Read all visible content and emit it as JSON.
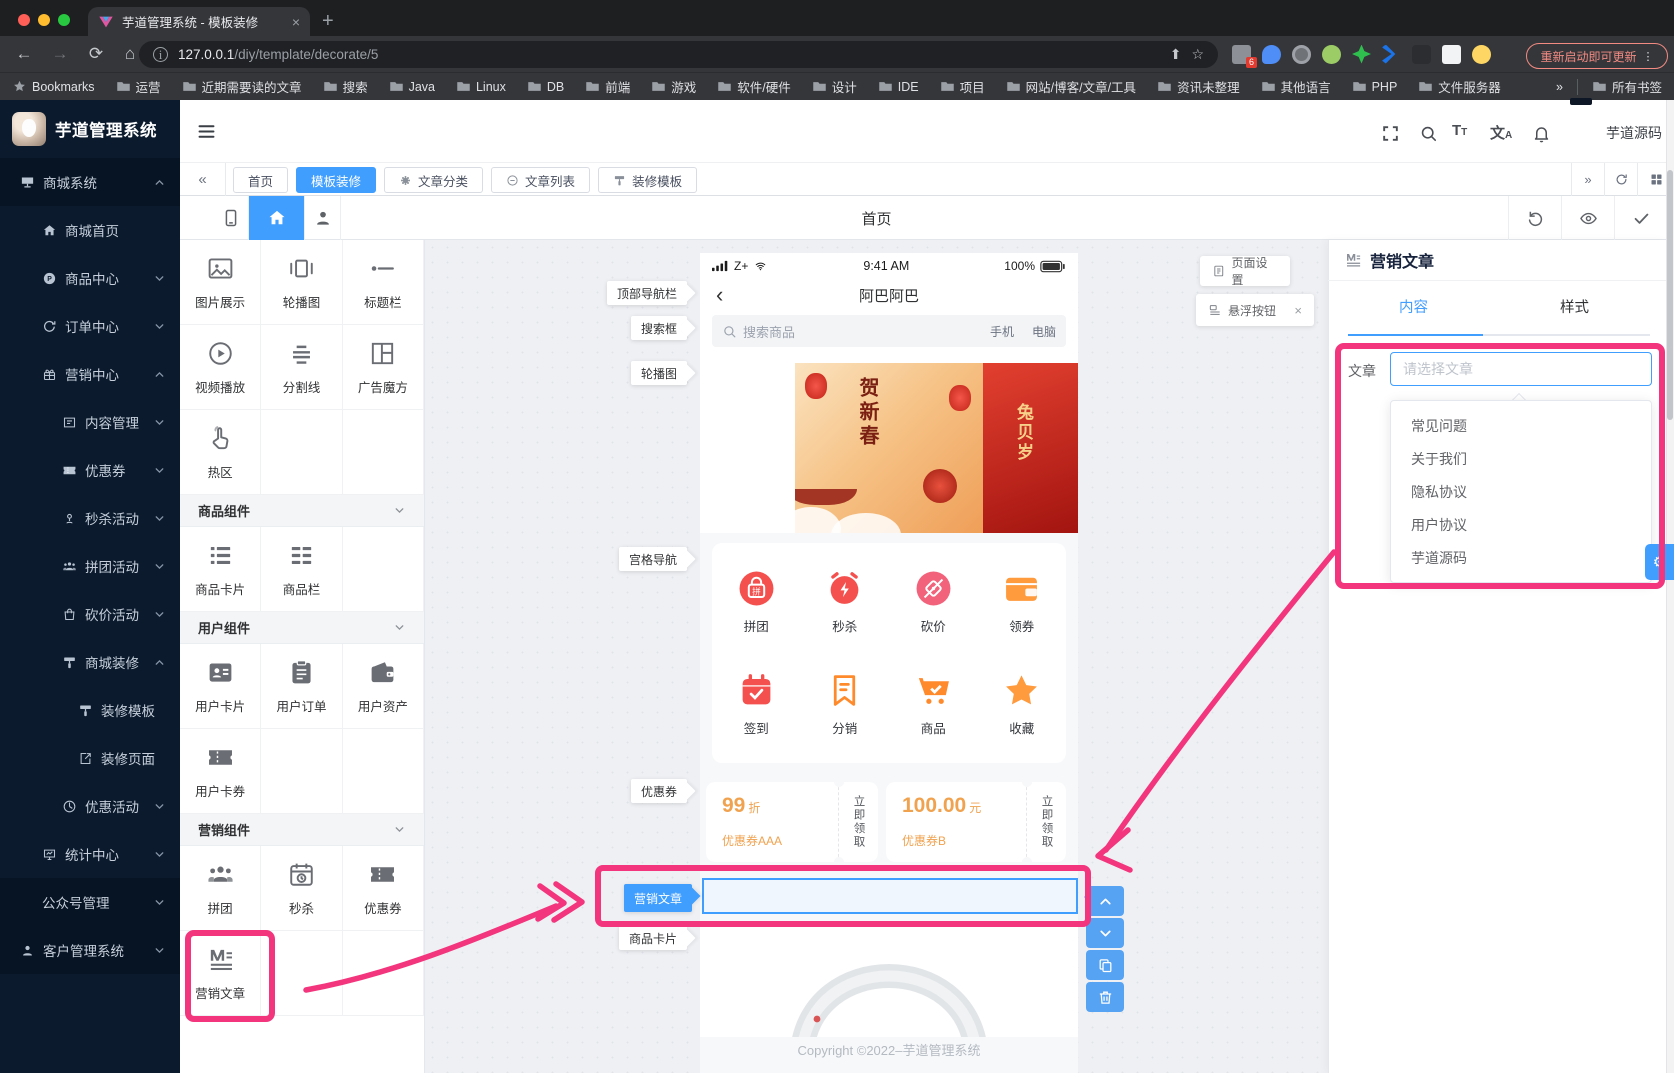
{
  "browser": {
    "tab_title": "芋道管理系统 - 模板装修",
    "new_tab": "+",
    "close_tab": "×",
    "url_host": "127.0.0.1",
    "url_path": "/diy/template/decorate/5",
    "update_button": "重新启动即可更新",
    "menu_dots": "⋮",
    "bookmarks_label": "Bookmarks",
    "bookmarks": [
      "运营",
      "近期需要读的文章",
      "搜索",
      "Java",
      "Linux",
      "DB",
      "前端",
      "游戏",
      "软件/硬件",
      "设计",
      "IDE",
      "项目",
      "网站/博客/文章/工具",
      "资讯未整理",
      "其他语言",
      "PHP",
      "文件服务器"
    ],
    "overflow": "»",
    "all_bookmarks": "所有书签",
    "extension_badge": "6"
  },
  "sidebar": {
    "title": "芋道管理系统",
    "items": [
      {
        "label": "商城系统",
        "icon": "shop-icon",
        "arrow": "chevron-up-icon",
        "indent": 0,
        "dark": true
      },
      {
        "label": "商城首页",
        "icon": "home-icon",
        "arrow": "",
        "indent": 1
      },
      {
        "label": "商品中心",
        "icon": "product-icon",
        "arrow": "chevron-down-icon",
        "indent": 1
      },
      {
        "label": "订单中心",
        "icon": "order-icon",
        "arrow": "chevron-down-icon",
        "indent": 1
      },
      {
        "label": "营销中心",
        "icon": "marketing-icon",
        "arrow": "chevron-up-icon",
        "indent": 1
      },
      {
        "label": "内容管理",
        "icon": "content-icon",
        "arrow": "chevron-down-icon",
        "indent": 2
      },
      {
        "label": "优惠券",
        "icon": "ticket-icon",
        "arrow": "chevron-down-icon",
        "indent": 2
      },
      {
        "label": "秒杀活动",
        "icon": "seckill-icon",
        "arrow": "chevron-down-icon",
        "indent": 2
      },
      {
        "label": "拼团活动",
        "icon": "group-icon",
        "arrow": "chevron-down-icon",
        "indent": 2
      },
      {
        "label": "砍价活动",
        "icon": "bargain-icon",
        "arrow": "chevron-down-icon",
        "indent": 2
      },
      {
        "label": "商城装修",
        "icon": "brush-icon",
        "arrow": "chevron-up-icon",
        "indent": 2
      },
      {
        "label": "装修模板",
        "icon": "brush-icon",
        "arrow": "",
        "indent": 3
      },
      {
        "label": "装修页面",
        "icon": "page-icon",
        "arrow": "",
        "indent": 3
      },
      {
        "label": "优惠活动",
        "icon": "activity-icon",
        "arrow": "chevron-down-icon",
        "indent": 2
      },
      {
        "label": "统计中心",
        "icon": "stats-icon",
        "arrow": "chevron-down-icon",
        "indent": 1
      },
      {
        "label": "公众号管理",
        "icon": "",
        "arrow": "chevron-down-icon",
        "indent": 1,
        "dark": true
      },
      {
        "label": "客户管理系统",
        "icon": "customer-icon",
        "arrow": "chevron-down-icon",
        "indent": 0,
        "dark": true
      }
    ]
  },
  "header": {
    "username": "芋道源码"
  },
  "tabbar": {
    "collapse": "«",
    "tabs": [
      {
        "label": "首页",
        "icon": ""
      },
      {
        "label": "模板装修",
        "icon": "",
        "active": true
      },
      {
        "label": "文章分类",
        "icon": "flower-icon"
      },
      {
        "label": "文章列表",
        "icon": "link-icon"
      },
      {
        "label": "装修模板",
        "icon": "brush-icon"
      }
    ],
    "expand": "»"
  },
  "canvas": {
    "title": "首页"
  },
  "component_panel": {
    "groups": [
      {
        "title": "",
        "items": [
          {
            "label": "图片展示",
            "icon": "image-icon"
          },
          {
            "label": "轮播图",
            "icon": "carousel-icon"
          },
          {
            "label": "标题栏",
            "icon": "titlebar-icon"
          },
          {
            "label": "视频播放",
            "icon": "video-icon"
          },
          {
            "label": "分割线",
            "icon": "divider-icon"
          },
          {
            "label": "广告魔方",
            "icon": "cube-icon"
          },
          {
            "label": "热区",
            "icon": "hotzone-icon"
          }
        ]
      },
      {
        "title": "商品组件",
        "items": [
          {
            "label": "商品卡片",
            "icon": "list-icon"
          },
          {
            "label": "商品栏",
            "icon": "columns-icon"
          }
        ]
      },
      {
        "title": "用户组件",
        "items": [
          {
            "label": "用户卡片",
            "icon": "idcard-icon"
          },
          {
            "label": "用户订单",
            "icon": "clipboard-icon"
          },
          {
            "label": "用户资产",
            "icon": "wallet-icon"
          },
          {
            "label": "用户卡券",
            "icon": "ticket-icon"
          }
        ]
      },
      {
        "title": "营销组件",
        "items": [
          {
            "label": "拼团",
            "icon": "group-icon"
          },
          {
            "label": "秒杀",
            "icon": "calendar-icon"
          },
          {
            "label": "优惠券",
            "icon": "ticket-icon"
          },
          {
            "label": "营销文章",
            "icon": "article-icon",
            "highlight": true
          }
        ]
      }
    ]
  },
  "phone": {
    "carrier": "Z+",
    "time": "9:41 AM",
    "battery": "100%",
    "back": "‹",
    "nav_title": "阿巴阿巴",
    "search_placeholder": "搜索商品",
    "keyword1": "手机",
    "keyword2": "电脑",
    "carousel_text": "贺新春",
    "carousel_text2": "兔贝岁",
    "grid": [
      {
        "label": "拼团",
        "icon": "nav-group-icon"
      },
      {
        "label": "秒杀",
        "icon": "nav-flash-icon"
      },
      {
        "label": "砍价",
        "icon": "nav-bargain-icon"
      },
      {
        "label": "领券",
        "icon": "nav-coupon-icon"
      },
      {
        "label": "签到",
        "icon": "nav-sign-icon"
      },
      {
        "label": "分销",
        "icon": "nav-share-icon"
      },
      {
        "label": "商品",
        "icon": "nav-goods-icon"
      },
      {
        "label": "收藏",
        "icon": "nav-star-icon"
      }
    ],
    "coupons": [
      {
        "value": "99",
        "unit": "折",
        "name": "优惠券AAA",
        "action": "立即领取"
      },
      {
        "value": "100.00",
        "unit": "元",
        "name": "优惠券B",
        "action": "立即领取"
      }
    ],
    "copyright": "Copyright ©2022–芋道管理系统"
  },
  "labels": [
    {
      "label": "顶部导航栏",
      "key": "topnav"
    },
    {
      "label": "搜索框",
      "key": "search"
    },
    {
      "label": "轮播图",
      "key": "carousel"
    },
    {
      "label": "宫格导航",
      "key": "grid"
    },
    {
      "label": "优惠券",
      "key": "coupon"
    },
    {
      "label": "营销文章",
      "key": "article",
      "active": true
    },
    {
      "label": "商品卡片",
      "key": "product"
    }
  ],
  "float_buttons": {
    "page_setting": "页面设置",
    "float_button": "悬浮按钮",
    "close": "×"
  },
  "right_panel": {
    "title": "营销文章",
    "tab_content": "内容",
    "tab_style": "样式",
    "field_label": "文章",
    "placeholder": "请选择文章",
    "options": [
      "常见问题",
      "关于我们",
      "隐私协议",
      "用户协议",
      "芋道源码"
    ]
  },
  "colors": {
    "accent": "#409eff",
    "annotation": "#f2357d",
    "sidebar_bg": "#0b1b2d",
    "red": "#f4504e",
    "orange": "#ff9a3d",
    "coupon_text": "#f0a24f"
  }
}
